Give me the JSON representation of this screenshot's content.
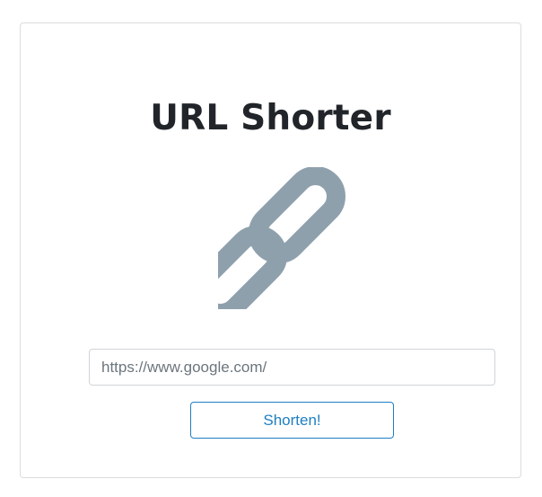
{
  "app": {
    "title": "URL Shorter"
  },
  "icon": {
    "name": "link-chain-icon",
    "color": "#8fa0ad"
  },
  "form": {
    "url_value": "",
    "url_placeholder": "https://www.google.com/",
    "submit_label": "Shorten!"
  },
  "colors": {
    "title": "#212529",
    "accent": "#1e7fc1",
    "border": "#dcdcdc"
  }
}
